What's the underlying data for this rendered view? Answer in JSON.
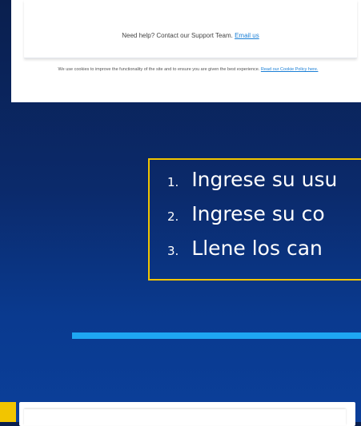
{
  "support": {
    "help_text": "Need help? Contact our Support Team.",
    "email_link": "Email us"
  },
  "cookie": {
    "text": "We use cookies to improve the functionality of the site and to ensure you are given the best experience.",
    "link": "Read our Cookie Policy here."
  },
  "steps": [
    {
      "num": "1.",
      "text": "Ingrese su usu"
    },
    {
      "num": "2.",
      "text": "Ingrese su co"
    },
    {
      "num": "3.",
      "text": "Llene los can"
    }
  ],
  "colors": {
    "highlight_border": "#f2c500",
    "accent_line": "#1ea7f2",
    "background": "#0b2a6b"
  }
}
